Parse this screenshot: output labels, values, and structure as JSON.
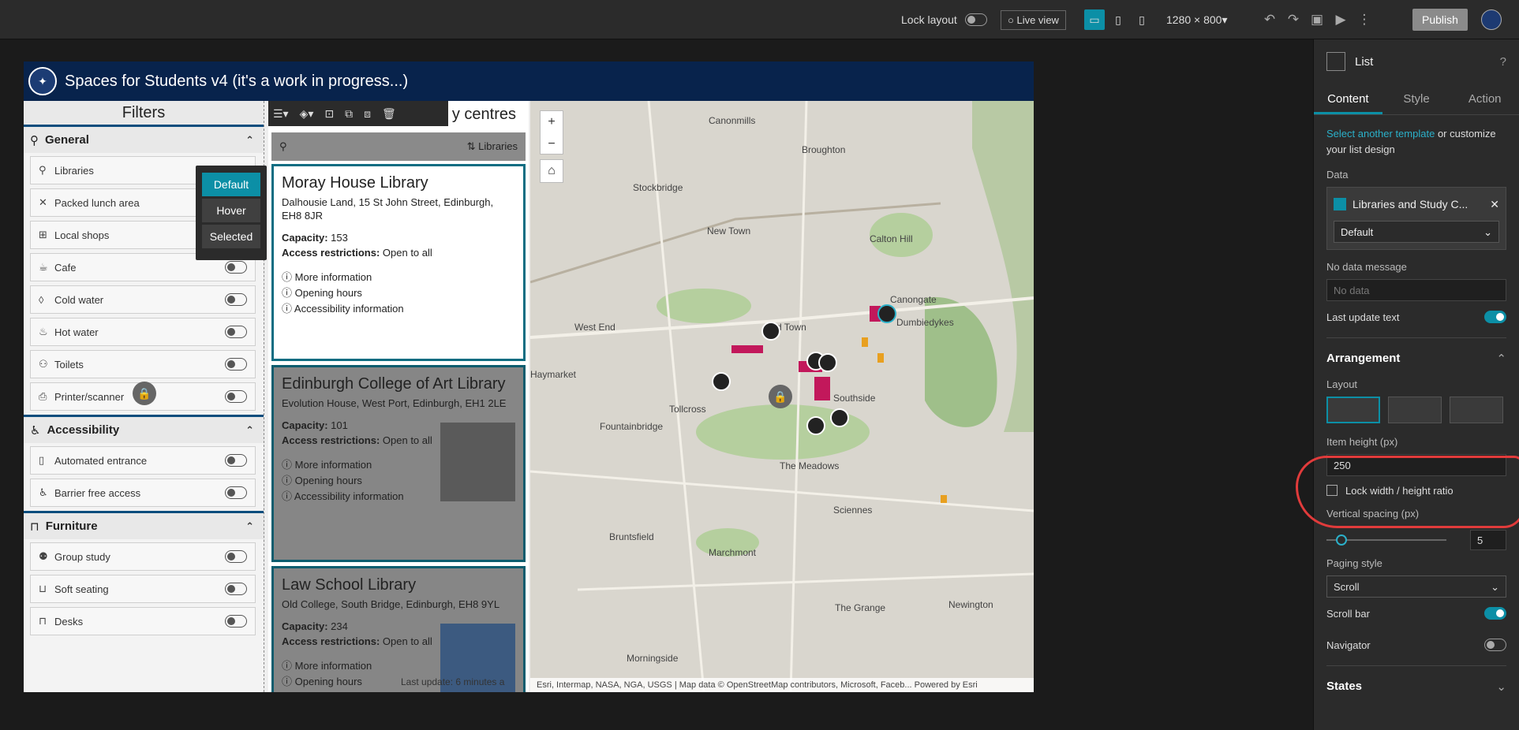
{
  "topbar": {
    "lock_layout_label": "Lock layout",
    "live_view_label": "Live view",
    "resolution": "1280 × 800",
    "publish_label": "Publish"
  },
  "app": {
    "title": "Spaces for Students v4 (it's a work in progress...)"
  },
  "filters": {
    "title": "Filters",
    "sections": [
      {
        "title": "General",
        "items": [
          "Libraries",
          "Packed lunch area",
          "Local shops",
          "Cafe",
          "Cold water",
          "Hot water",
          "Toilets",
          "Printer/scanner"
        ]
      },
      {
        "title": "Accessibility",
        "items": [
          "Automated entrance",
          "Barrier free access"
        ]
      },
      {
        "title": "Furniture",
        "items": [
          "Group study",
          "Soft seating",
          "Desks"
        ]
      }
    ]
  },
  "state_popup": {
    "items": [
      "Default",
      "Hover",
      "Selected"
    ]
  },
  "list": {
    "title_fragment": "y centres",
    "sort_label": "Libraries",
    "cards": [
      {
        "title": "Moray House Library",
        "address": "Dalhousie Land, 15 St John Street, Edinburgh, EH8 8JR",
        "capacity": "153",
        "access": "Open to all"
      },
      {
        "title": "Edinburgh College of Art Library",
        "address": "Evolution House, West Port, Edinburgh, EH1 2LE",
        "capacity": "101",
        "access": "Open to all"
      },
      {
        "title": "Law School Library",
        "address": "Old College, South Bridge, Edinburgh, EH8 9YL",
        "capacity": "234",
        "access": "Open to all"
      }
    ],
    "capacity_label": "Capacity:",
    "access_label": "Access restrictions:",
    "link_more": "More information",
    "link_hours": "Opening hours",
    "link_access": "Accessibility information",
    "last_update": "Last update: 6 minutes a"
  },
  "map": {
    "attribution": "Esri, Intermap, NASA, NGA, USGS | Map data © OpenStreetMap contributors, Microsoft, Faceb...    Powered by Esri",
    "labels": [
      "Canonmills",
      "Broughton",
      "Stockbridge",
      "New Town",
      "Calton Hill",
      "Canongate",
      "Dumbiedykes",
      "West End",
      "Old Town",
      "Haymarket",
      "Tollcross",
      "Southside",
      "Fountainbridge",
      "The Meadows",
      "Bruntsfield",
      "Marchmont",
      "Sciennes",
      "The Grange",
      "Newington",
      "Morningside"
    ]
  },
  "panel": {
    "title": "List",
    "tabs": [
      "Content",
      "Style",
      "Action"
    ],
    "template_link": "Select another template",
    "template_rest": "or customize your list design",
    "data_label": "Data",
    "datasource": "Libraries and Study C...",
    "datasource_view": "Default",
    "nodata_label": "No data message",
    "nodata_placeholder": "No data",
    "last_update_label": "Last update text",
    "arrangement": "Arrangement",
    "layout_label": "Layout",
    "item_height_label": "Item height (px)",
    "item_height": "250",
    "lock_ratio_label": "Lock width / height ratio",
    "vspacing_label": "Vertical spacing (px)",
    "vspacing": "5",
    "paging_label": "Paging style",
    "paging": "Scroll",
    "scrollbar_label": "Scroll bar",
    "navigator_label": "Navigator",
    "states_label": "States"
  }
}
